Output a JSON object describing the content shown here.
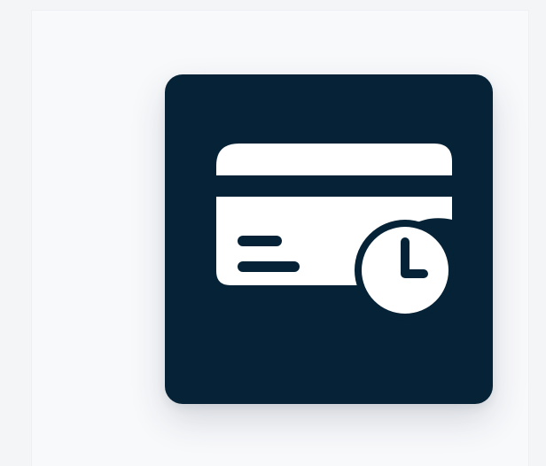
{
  "app_icon": {
    "name": "card-payment-schedule",
    "icon_semantic": "credit-card-clock-icon",
    "colors": {
      "background": "#f4f5f7",
      "panel": "#f8f9fb",
      "tile": "#052236",
      "foreground": "#ffffff"
    }
  }
}
